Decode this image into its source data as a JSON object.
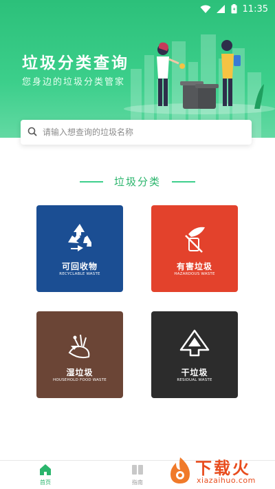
{
  "status_bar": {
    "time": "11:35"
  },
  "header": {
    "title": "垃圾分类查询",
    "subtitle": "您身边的垃圾分类管家"
  },
  "search": {
    "placeholder": "请输入想查询的垃圾名称"
  },
  "section": {
    "title": "垃圾分类"
  },
  "categories": [
    {
      "name": "可回收物",
      "en": "RECYCLABLE WASTE",
      "color": "#1b4e93",
      "icon": "recycle-icon"
    },
    {
      "name": "有害垃圾",
      "en": "HAZARDOUS WASTE",
      "color": "#e3422c",
      "icon": "hazardous-icon"
    },
    {
      "name": "湿垃圾",
      "en": "HOUSEHOLD FOOD WASTE",
      "color": "#6b4536",
      "icon": "food-waste-icon"
    },
    {
      "name": "干垃圾",
      "en": "RESIDUAL WASTE",
      "color": "#2c2c2c",
      "icon": "residual-icon"
    }
  ],
  "tabbar": {
    "tabs": [
      {
        "label": "首页",
        "icon": "home-icon",
        "active": true
      },
      {
        "label": "指南",
        "icon": "book-icon",
        "active": false
      }
    ]
  },
  "watermark": {
    "cn": "下载火",
    "en": "xiazaihuo.com"
  },
  "colors": {
    "accent": "#2ab56c",
    "header": "#3ccf8b"
  }
}
